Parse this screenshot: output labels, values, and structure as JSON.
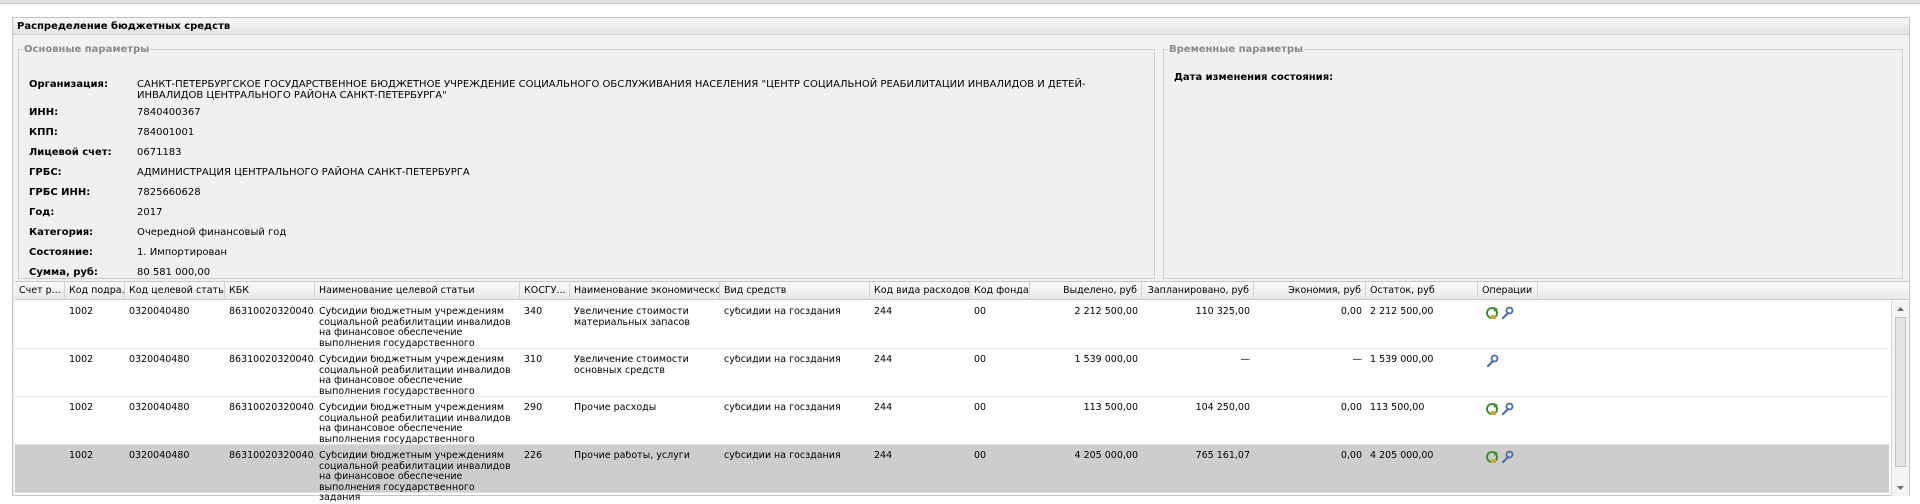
{
  "panel": {
    "title": "Распределение бюджетных средств",
    "main_legend": "Основные параметры",
    "time_legend": "Временные параметры",
    "fields": [
      {
        "label": "Организация:",
        "value": "САНКТ-ПЕТЕРБУРГСКОЕ ГОСУДАРСТВЕННОЕ БЮДЖЕТНОЕ УЧРЕЖДЕНИЕ СОЦИАЛЬНОГО ОБСЛУЖИВАНИЯ НАСЕЛЕНИЯ \"ЦЕНТР СОЦИАЛЬНОЙ РЕАБИЛИТАЦИИ ИНВАЛИДОВ И ДЕТЕЙ-ИНВАЛИДОВ ЦЕНТРАЛЬНОГО РАЙОНА САНКТ-ПЕТЕРБУРГА\""
      },
      {
        "label": "ИНН:",
        "value": "7840400367"
      },
      {
        "label": "КПП:",
        "value": "784001001"
      },
      {
        "label": "Лицевой счет:",
        "value": "0671183"
      },
      {
        "label": "ГРБС:",
        "value": "АДМИНИСТРАЦИЯ ЦЕНТРАЛЬНОГО РАЙОНА САНКТ-ПЕТЕРБУРГА"
      },
      {
        "label": "ГРБС ИНН:",
        "value": "7825660628"
      },
      {
        "label": "Год:",
        "value": "2017"
      },
      {
        "label": "Категория:",
        "value": "Очередной финансовый год"
      },
      {
        "label": "Состояние:",
        "value": "1. Импортирован"
      },
      {
        "label": "Сумма, руб:",
        "value": "80 581 000,00"
      }
    ],
    "time_field": {
      "label": "Дата изменения состояния:",
      "value": "-"
    }
  },
  "grid": {
    "columns": [
      "Счет р...",
      "Код подра...",
      "Код целевой статьи",
      "КБК",
      "Наименование целевой статьи",
      "КОСГУ...",
      "Наименование экономической ...",
      "Вид средств",
      "Код вида расходов",
      "Код фонда",
      "Выделено, руб",
      "Запланировано, руб",
      "Экономия, руб",
      "Остаток, руб",
      "Операции"
    ],
    "rows": [
      {
        "cells": [
          "",
          "1002",
          "0320040480",
          "86310020320040...",
          "Субсидии бюджетным учреждениям социальной реабилитации инвалидов на финансовое обеспечение выполнения государственного задания",
          "340",
          "Увеличение стоимости материальных запасов",
          "субсидии на госздания",
          "244",
          "00",
          "2 212 500,00",
          "110 325,00",
          "0,00",
          "2 212 500,00"
        ],
        "ops": [
          "refresh-icon",
          "wrench-icon"
        ],
        "selected": false
      },
      {
        "cells": [
          "",
          "1002",
          "0320040480",
          "86310020320040...",
          "Субсидии бюджетным учреждениям социальной реабилитации инвалидов на финансовое обеспечение выполнения государственного задания",
          "310",
          "Увеличение стоимости основных средств",
          "субсидии на госздания",
          "244",
          "00",
          "1 539 000,00",
          "—",
          "—",
          "1 539 000,00"
        ],
        "ops": [
          "wrench-icon"
        ],
        "selected": false
      },
      {
        "cells": [
          "",
          "1002",
          "0320040480",
          "86310020320040...",
          "Субсидии бюджетным учреждениям социальной реабилитации инвалидов на финансовое обеспечение выполнения государственного задания",
          "290",
          "Прочие расходы",
          "субсидии на госздания",
          "244",
          "00",
          "113 500,00",
          "104 250,00",
          "0,00",
          "113 500,00"
        ],
        "ops": [
          "refresh-icon",
          "wrench-icon"
        ],
        "selected": false
      },
      {
        "cells": [
          "",
          "1002",
          "0320040480",
          "86310020320040...",
          "Субсидии бюджетным учреждениям социальной реабилитации инвалидов на финансовое обеспечение выполнения государственного задания",
          "226",
          "Прочие работы, услуги",
          "субсидии на госздания",
          "244",
          "00",
          "4 205 000,00",
          "765 161,07",
          "0,00",
          "4 205 000,00"
        ],
        "ops": [
          "refresh-icon",
          "wrench-icon"
        ],
        "selected": true
      }
    ]
  }
}
